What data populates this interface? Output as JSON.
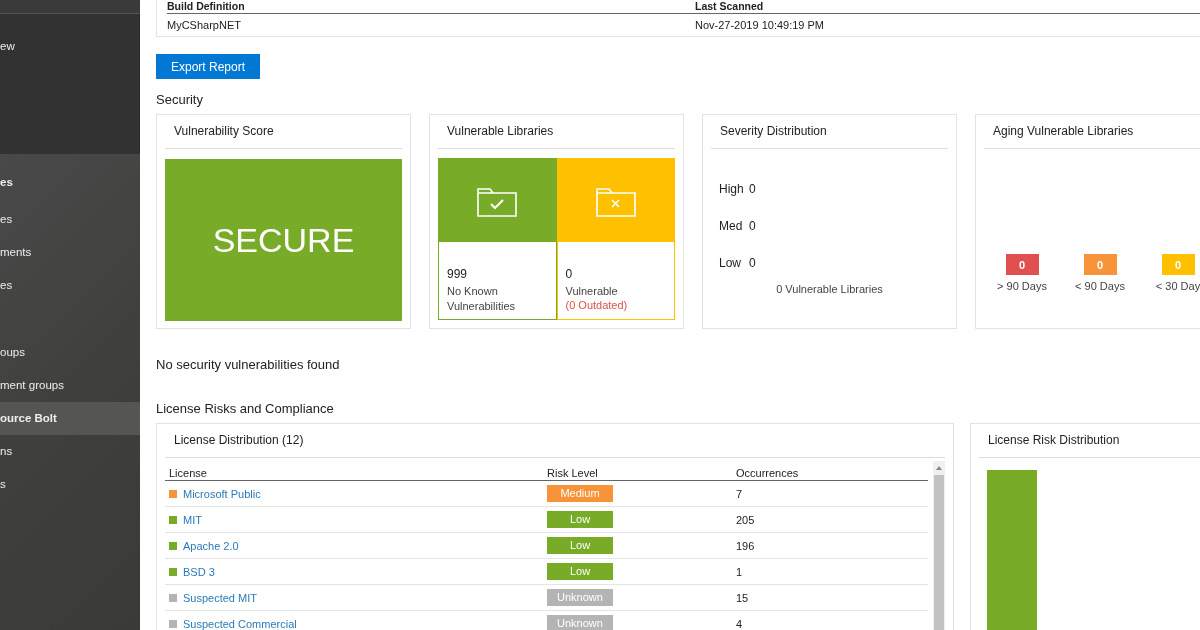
{
  "sidebar": {
    "items": [
      {
        "label": "ew",
        "kind": "top",
        "selected": false
      },
      {
        "label": "es",
        "kind": "header",
        "selected": false
      },
      {
        "label": "es",
        "kind": "item",
        "selected": false
      },
      {
        "label": "ments",
        "kind": "item",
        "selected": false
      },
      {
        "label": "es",
        "kind": "item",
        "selected": false
      },
      {
        "label": "oups",
        "kind": "item",
        "selected": false
      },
      {
        "label": "ment groups",
        "kind": "item",
        "selected": false
      },
      {
        "label": "ource Bolt",
        "kind": "item",
        "selected": true
      },
      {
        "label": "ns",
        "kind": "item",
        "selected": false
      },
      {
        "label": "s",
        "kind": "item",
        "selected": false
      }
    ]
  },
  "build_table": {
    "columns": [
      "Build Definition",
      "Last Scanned"
    ],
    "rows": [
      [
        "MyCSharpNET",
        "Nov-27-2019 10:49:19 PM"
      ]
    ]
  },
  "export_button": "Export Report",
  "security": {
    "title": "Security",
    "vulnerability_score": {
      "title": "Vulnerability Score",
      "status": "SECURE"
    },
    "vulnerable_libraries": {
      "title": "Vulnerable Libraries",
      "tiles": [
        {
          "kind": "ok",
          "count": "999",
          "label": "No Known Vulnerabilities"
        },
        {
          "kind": "vulnerable",
          "count": "0",
          "label": "Vulnerable",
          "note": "(0 Outdated)"
        }
      ]
    },
    "severity_distribution": {
      "title": "Severity Distribution",
      "rows": [
        {
          "label": "High",
          "value": "0"
        },
        {
          "label": "Med",
          "value": "0"
        },
        {
          "label": "Low",
          "value": "0"
        }
      ],
      "total": "0 Vulnerable Libraries"
    },
    "aging": {
      "title": "Aging Vulnerable Libraries",
      "buckets": [
        {
          "value": "0",
          "label": "> 90 Days",
          "color": "#e05050"
        },
        {
          "value": "0",
          "label": "< 90 Days",
          "color": "#f7943a"
        },
        {
          "value": "0",
          "label": "< 30 Day",
          "color": "#ffc000"
        }
      ]
    }
  },
  "security_message": "No security vulnerabilities found",
  "license": {
    "title": "License Risks and Compliance",
    "distribution": {
      "title": "License Distribution (12)",
      "columns": [
        "License",
        "Risk Level",
        "Occurrences"
      ],
      "rows": [
        {
          "name": "Microsoft Public",
          "risk": "Medium",
          "occurrences": "7",
          "color": "#f7943a"
        },
        {
          "name": "MIT",
          "risk": "Low",
          "occurrences": "205",
          "color": "#78ab27"
        },
        {
          "name": "Apache 2.0",
          "risk": "Low",
          "occurrences": "196",
          "color": "#78ab27"
        },
        {
          "name": "BSD 3",
          "risk": "Low",
          "occurrences": "1",
          "color": "#78ab27"
        },
        {
          "name": "Suspected MIT",
          "risk": "Unknown",
          "occurrences": "15",
          "color": "#b4b4b4"
        },
        {
          "name": "Suspected Commercial",
          "risk": "Unknown",
          "occurrences": "4",
          "color": "#b4b4b4"
        }
      ]
    },
    "risk_distribution": {
      "title": "License Risk Distribution"
    }
  }
}
